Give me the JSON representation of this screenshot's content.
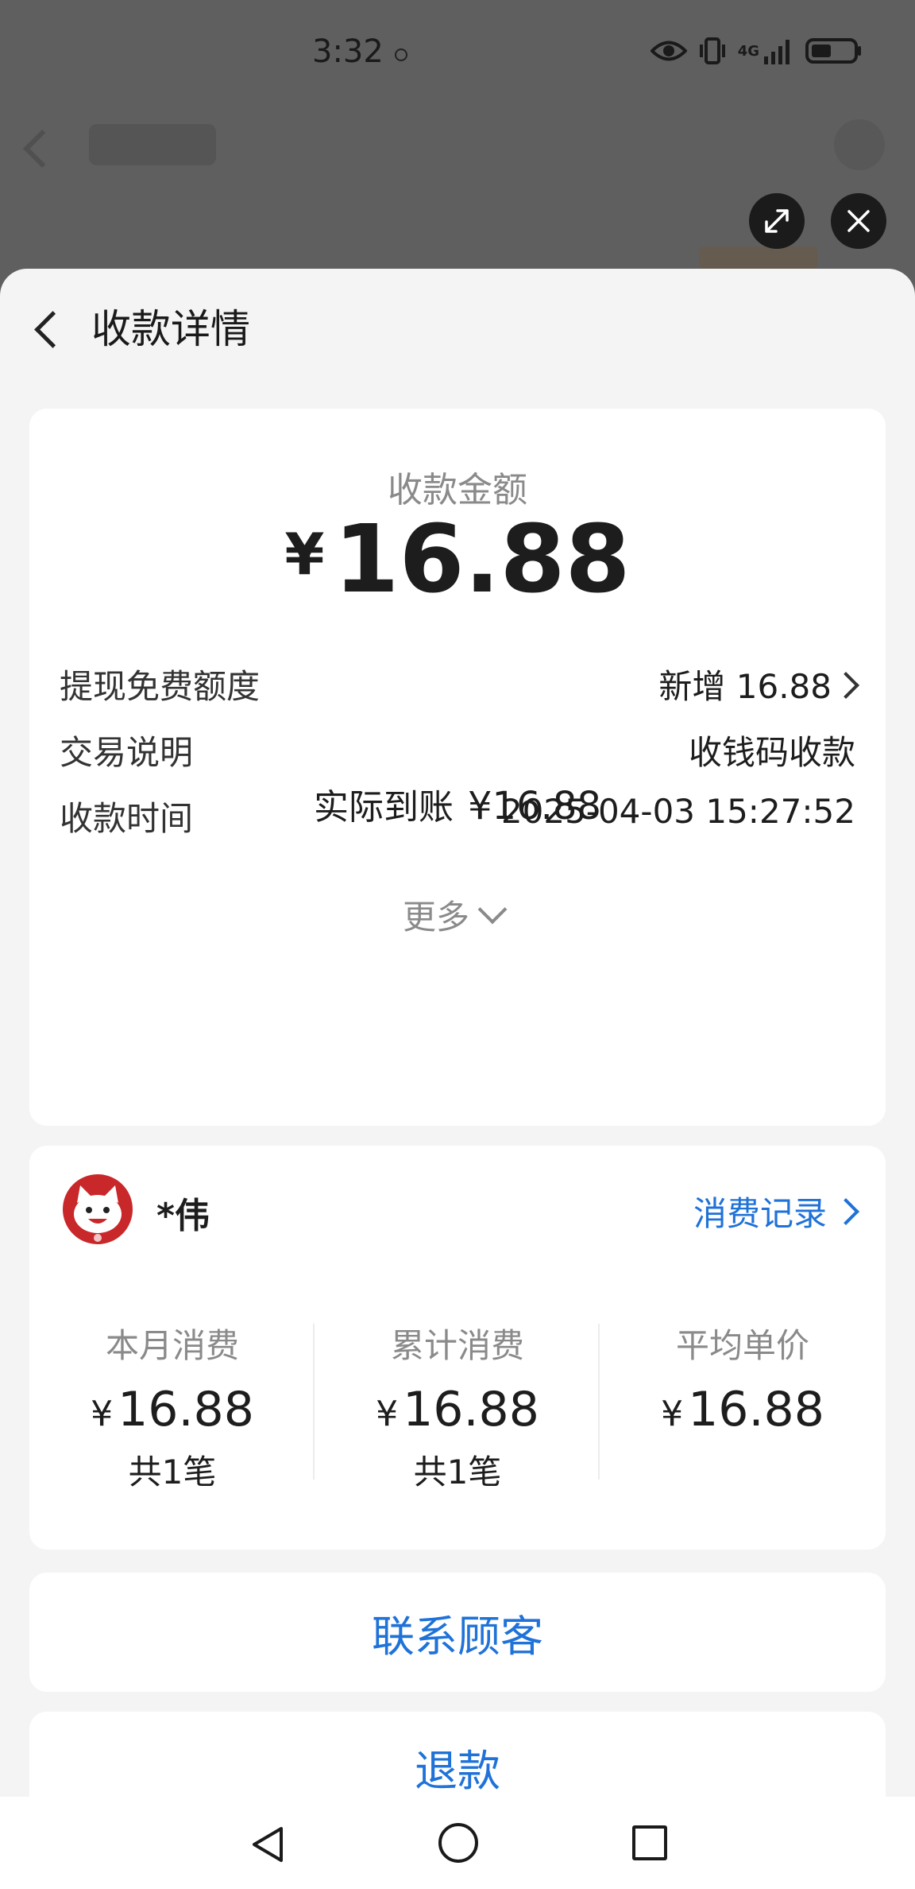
{
  "status_bar": {
    "time": "3:32",
    "network": "4G"
  },
  "sheet": {
    "title": "收款详情"
  },
  "amount_card": {
    "label": "收款金额",
    "currency": "¥",
    "amount": "16.88",
    "net_label": "实际到账",
    "net_amount": "¥16.88",
    "rows": [
      {
        "key": "提现免费额度",
        "value": "新增 16.88"
      },
      {
        "key": "交易说明",
        "value": "收钱码收款"
      },
      {
        "key": "收款时间",
        "value": "2025-04-03 15:27:52"
      }
    ],
    "more_label": "更多"
  },
  "customer_card": {
    "name": "*伟",
    "records_link": "消费记录",
    "stats": [
      {
        "label": "本月消费",
        "currency": "¥",
        "value": "16.88",
        "count": "共1笔"
      },
      {
        "label": "累计消费",
        "currency": "¥",
        "value": "16.88",
        "count": "共1笔"
      },
      {
        "label": "平均单价",
        "currency": "¥",
        "value": "16.88",
        "count": ""
      }
    ]
  },
  "actions": {
    "contact": "联系顾客",
    "refund": "退款"
  },
  "colors": {
    "accent": "#1f72d8",
    "sheet_bg": "#f4f4f4",
    "card_bg": "#ffffff",
    "dim_overlay": "#5f5f5f"
  }
}
